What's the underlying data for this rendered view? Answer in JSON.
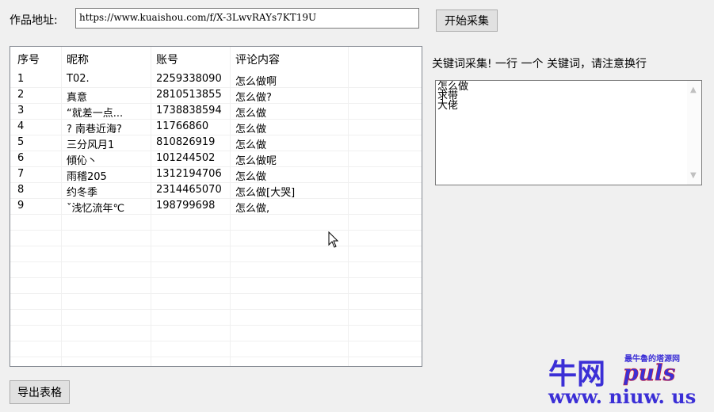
{
  "form": {
    "url_label": "作品地址:",
    "url_value": "https://www.kuaishou.com/f/X-3LwvRAYs7KT19U",
    "start_button": "开始采集",
    "export_button": "导出表格"
  },
  "table": {
    "headers": [
      "序号",
      "昵称",
      "账号",
      "评论内容"
    ],
    "rows": [
      [
        "1",
        "T02.",
        "2259338090",
        "怎么做啊"
      ],
      [
        "2",
        "真意",
        "2810513855",
        "怎么做?"
      ],
      [
        "3",
        "“就差一点...",
        "1738838594",
        "怎么做"
      ],
      [
        "4",
        "? 南巷近海?",
        "11766860",
        "怎么做"
      ],
      [
        "5",
        "三分风月1",
        "810826919",
        "怎么做"
      ],
      [
        "6",
        "傾伈丶",
        "101244502",
        "怎么做呢"
      ],
      [
        "7",
        "雨稽205",
        "1312194706",
        "怎么做"
      ],
      [
        "8",
        "约冬季",
        "2314465070",
        "怎么做[大哭]"
      ],
      [
        "9",
        "ˇ浅忆流年℃",
        "198799698",
        "怎么做,"
      ]
    ]
  },
  "keywords": {
    "instruction": "关键词采集! 一行 一个 关键词，请注意换行",
    "text": "怎么做\n求带\n大佬"
  },
  "watermark": {
    "brand": "牛网",
    "brand_latin": "puls",
    "tagline": "最牛魯的塔源网",
    "url": "www. niuw. us",
    "colors": {
      "blue": "#3b2fd6",
      "red": "#e0282a"
    }
  }
}
